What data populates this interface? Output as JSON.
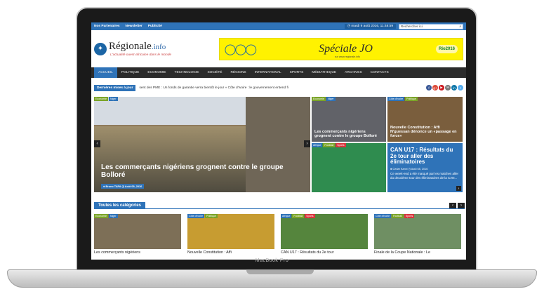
{
  "topbar": {
    "links": [
      "Nos Partenaires",
      "Newsletter",
      "Publicité"
    ],
    "date": "mardi 9 août 2016, 11:48:59",
    "search_placeholder": "Rechercher ici",
    "search_icon": "search-icon"
  },
  "header": {
    "logo_name": "Régionale",
    "logo_ext": ".info",
    "tagline": "L'actualité ouest-africaine dans le monde",
    "banner": {
      "title": "Spéciale JO",
      "subtitle": "sur www.regionale.info",
      "badge": "Rio2016"
    }
  },
  "nav": [
    "ACCUEIL",
    "POLITIQUE",
    "ECONOMIE",
    "TECHNOLOGIE",
    "SOCIÉTÉ",
    "RÉGIONS",
    "INTERNATIONAL",
    "SPORTS",
    "MÉDIATHEQUE",
    "ARCHIVES",
    "CONTACTS"
  ],
  "ticker": {
    "label": "Dernières mises à jour",
    "text": "sent des PME : Un fonds de garantie verra bientôt le jour  » Côte d'Ivoire : le gouvernement entend fi",
    "socials": [
      "f",
      "g+",
      "▶",
      "✉",
      "in",
      "t"
    ]
  },
  "featured": {
    "tags": [
      "Economie",
      "Niger"
    ],
    "title": "Les commerçants nigériens grognent contre le groupe Bolloré",
    "author": "♣ Bruno TAPA",
    "date": "Août 09, 2016"
  },
  "cards": [
    {
      "tags": [
        "Economie",
        "Niger"
      ],
      "title": "Les commerçants nigériens grognent contre le groupe Bolloré"
    },
    {
      "tags": [
        "Côte d'Ivoire",
        "Politique"
      ],
      "title": "Nouvelle Constitution : Affi N'guessan dénonce un «passage en force»"
    },
    {
      "tags": [
        "Afrique",
        "Football",
        "Sports"
      ],
      "title": ""
    },
    {
      "title": "CAN U17 : Résultats du 2e tour aller des éliminatoires",
      "author": "♣ Cedar Kanvi",
      "date": "Août 08, 2016",
      "desc": "Ce week-end a été marqué par les matches aller du deuxième tour des éliminatoires de la CAN..."
    }
  ],
  "categories": {
    "title": "Toutes les catégories",
    "items": [
      {
        "tags": [
          "Economie",
          "Niger"
        ],
        "caption": "Les commerçants nigériens"
      },
      {
        "tags": [
          "Côte d'Ivoire",
          "Politique"
        ],
        "caption": "Nouvelle Constitution : Affi"
      },
      {
        "tags": [
          "Afrique",
          "Football",
          "Sports"
        ],
        "caption": "CAN U17 : Résultats du 2e tour"
      },
      {
        "tags": [
          "Côte d'Ivoire",
          "Football",
          "Sports"
        ],
        "caption": "Finale de la Coupe Nationale : Le"
      }
    ]
  },
  "laptop": {
    "brand": "MacBook Pro"
  },
  "colors": {
    "accent": "#2f73b8",
    "nav_bg": "#2b2b2b",
    "banner": "#fff200"
  }
}
